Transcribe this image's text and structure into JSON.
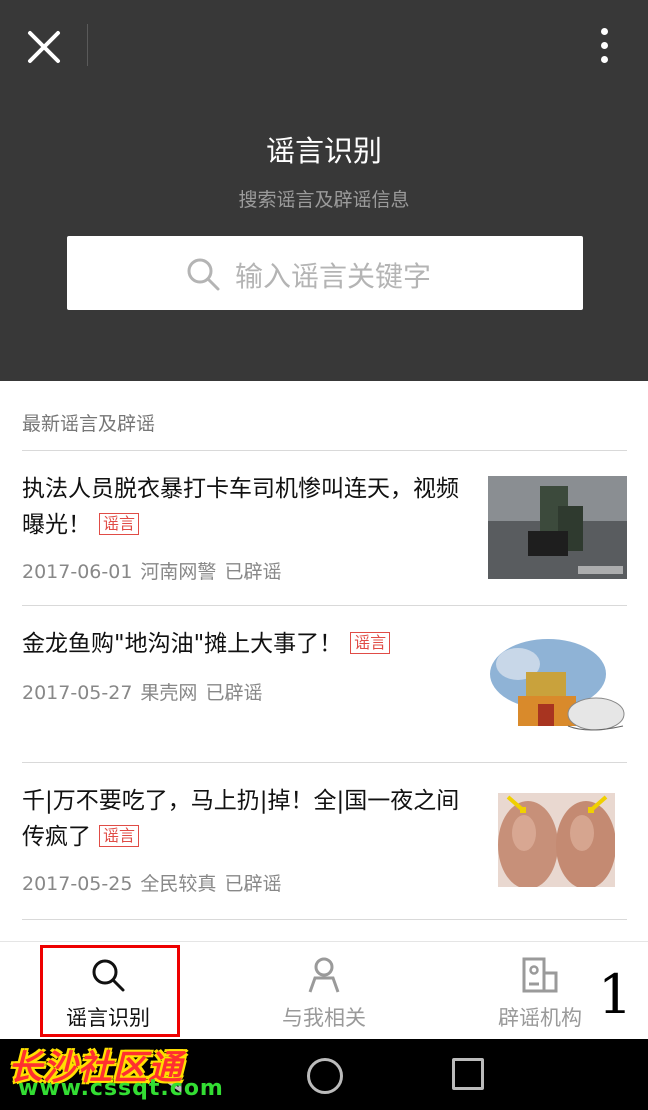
{
  "header": {
    "title": "谣言识别",
    "subtitle": "搜索谣言及辟谣信息",
    "search_placeholder": "输入谣言关键字"
  },
  "section_title": "最新谣言及辟谣",
  "tag_label": "谣言",
  "items": [
    {
      "title": "执法人员脱衣暴打卡车司机惨叫连天，视频曝光！",
      "date": "2017-06-01",
      "source": "河南网警",
      "status": "已辟谣"
    },
    {
      "title": "金龙鱼购\"地沟油\"摊上大事了！",
      "date": "2017-05-27",
      "source": "果壳网",
      "status": "已辟谣"
    },
    {
      "title": "千|万不要吃了，马上扔|掉！全|国一夜之间传疯了",
      "date": "2017-05-25",
      "source": "全民较真",
      "status": "已辟谣"
    }
  ],
  "tabs": [
    {
      "label": "谣言识别",
      "icon": "search-icon",
      "active": true
    },
    {
      "label": "与我相关",
      "icon": "person-icon",
      "active": false
    },
    {
      "label": "辟谣机构",
      "icon": "building-icon",
      "active": false
    }
  ],
  "annotation_number": "1",
  "watermark": {
    "line1": "长沙社区通",
    "line2": "www.cssqt.com"
  },
  "colors": {
    "header_bg": "#383838",
    "tag_red": "#e04c46",
    "tab_active": "#111111",
    "tab_inactive": "#9a9a9a"
  }
}
